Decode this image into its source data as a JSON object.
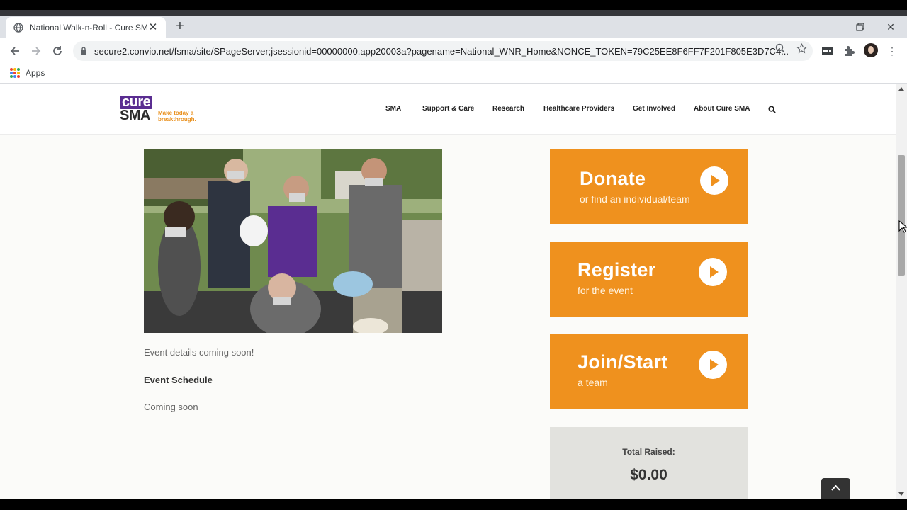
{
  "browser": {
    "tab_title": "National Walk-n-Roll - Cure SMA",
    "url": "secure2.convio.net/fsma/site/SPageServer;jsessionid=00000000.app20003a?pagename=National_WNR_Home&NONCE_TOKEN=79C25EE8F6FF7F201F805E3D7C4...",
    "bookmarks": [
      "Apps"
    ]
  },
  "site": {
    "logo": {
      "line1": "cure",
      "line2": "SMA",
      "tagline": "Make today a breakthrough."
    },
    "nav": [
      "SMA",
      "Support & Care",
      "Research",
      "Healthcare Providers",
      "Get Involved",
      "About Cure SMA"
    ]
  },
  "content": {
    "details": "Event details coming soon!",
    "schedule_heading": "Event Schedule",
    "schedule_text": "Coming soon"
  },
  "ctas": [
    {
      "title": "Donate",
      "subtitle": "or find an individual/team"
    },
    {
      "title": "Register",
      "subtitle": "for the event"
    },
    {
      "title": "Join/Start",
      "subtitle": "a team"
    }
  ],
  "raised": {
    "label": "Total Raised:",
    "amount": "$0.00"
  },
  "colors": {
    "accent": "#ef911e",
    "brand_purple": "#5a2d91"
  }
}
